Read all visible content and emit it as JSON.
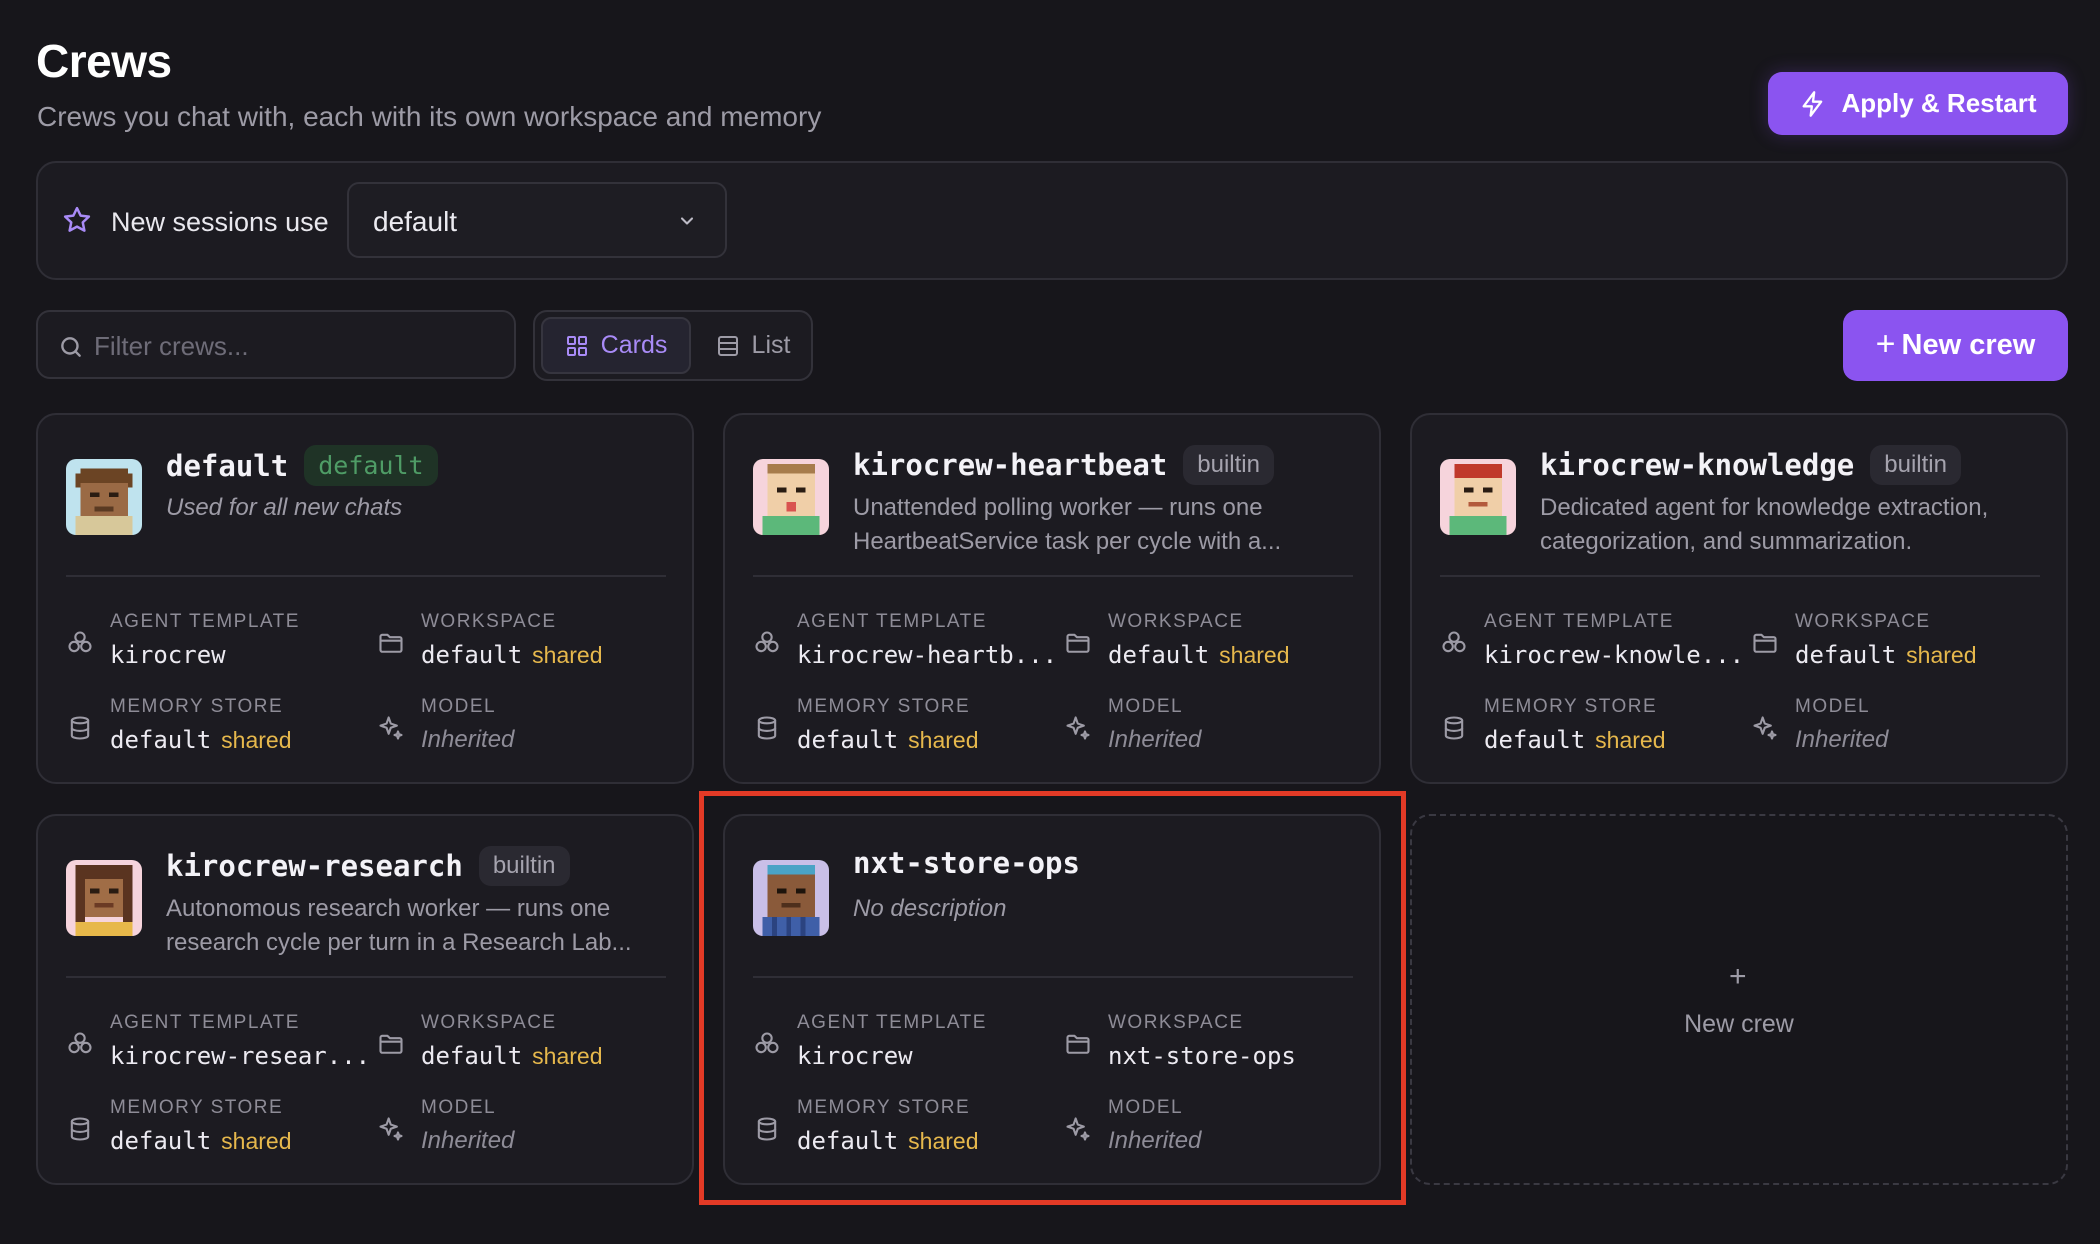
{
  "header": {
    "title": "Crews",
    "subtitle": "Crews you chat with, each with its own workspace and memory",
    "apply_label": "Apply & Restart"
  },
  "sessions": {
    "label": "New sessions use",
    "selected": "default"
  },
  "toolbar": {
    "filter_placeholder": "Filter crews...",
    "view_cards": "Cards",
    "view_list": "List",
    "new_crew_label": "New crew"
  },
  "labels": {
    "agent_template": "AGENT TEMPLATE",
    "workspace": "WORKSPACE",
    "memory_store": "MEMORY STORE",
    "model": "MODEL",
    "shared": "shared"
  },
  "crews": [
    {
      "name": "default",
      "badge": "default",
      "description": "Used for all new chats",
      "agent_template": "kirocrew",
      "workspace": "default",
      "workspace_shared": "shared",
      "memory_store": "default",
      "memory_shared": "shared",
      "model": "Inherited"
    },
    {
      "name": "kirocrew-heartbeat",
      "badge": "builtin",
      "description": "Unattended polling worker — runs one HeartbeatService task per cycle with a...",
      "agent_template": "kirocrew-heartb...",
      "workspace": "default",
      "workspace_shared": "shared",
      "memory_store": "default",
      "memory_shared": "shared",
      "model": "Inherited"
    },
    {
      "name": "kirocrew-knowledge",
      "badge": "builtin",
      "description": "Dedicated agent for knowledge extraction, categorization, and summarization.",
      "agent_template": "kirocrew-knowle...",
      "workspace": "default",
      "workspace_shared": "shared",
      "memory_store": "default",
      "memory_shared": "shared",
      "model": "Inherited"
    },
    {
      "name": "kirocrew-research",
      "badge": "builtin",
      "description": "Autonomous research worker — runs one research cycle per turn in a Research Lab...",
      "agent_template": "kirocrew-resear...",
      "workspace": "default",
      "workspace_shared": "shared",
      "memory_store": "default",
      "memory_shared": "shared",
      "model": "Inherited"
    },
    {
      "name": "nxt-store-ops",
      "badge": "",
      "description": "No description",
      "agent_template": "kirocrew",
      "workspace": "nxt-store-ops",
      "workspace_shared": "",
      "memory_store": "default",
      "memory_shared": "shared",
      "model": "Inherited"
    }
  ],
  "new_crew_card": {
    "plus": "+",
    "label": "New crew"
  },
  "colors": {
    "background": "#17161b",
    "accent": "#8b54f0",
    "shared_tag": "#e6b84c",
    "default_badge": "#4f9c66",
    "highlight": "#e33a26"
  }
}
